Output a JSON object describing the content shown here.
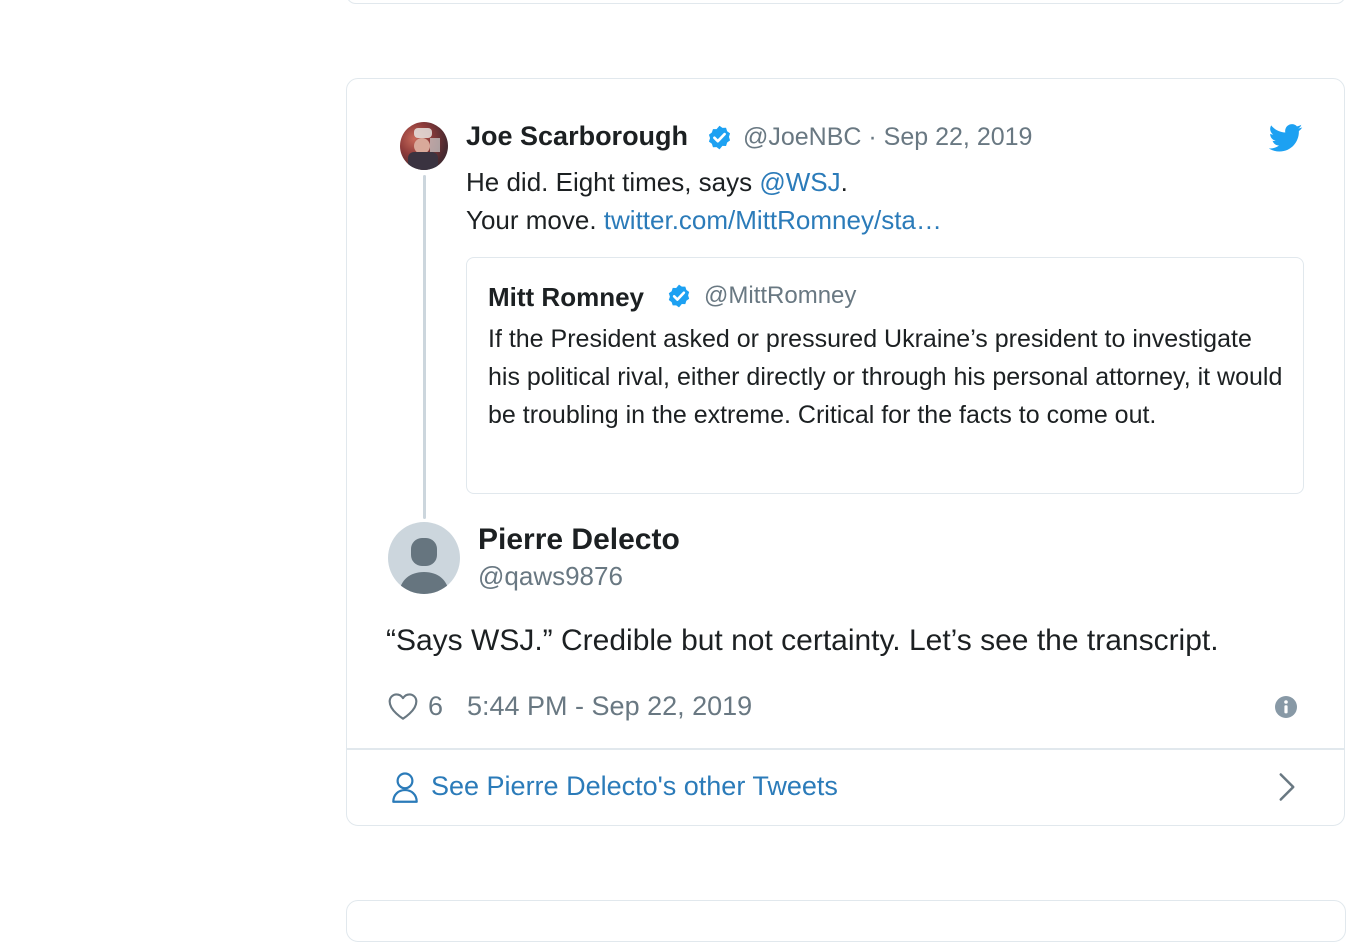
{
  "parent_tweet": {
    "author_name": "Joe Scarborough",
    "meta": "@JoeNBC · Sep 22, 2019",
    "line1_text": "He did. Eight times, says ",
    "line1_mention": "@WSJ",
    "line1_end": ".",
    "line2_text": "Your move. ",
    "line2_link": "twitter.com/MittRomney/sta…"
  },
  "quoted_tweet": {
    "author_name": "Mitt Romney",
    "handle": "@MittRomney",
    "text": "If the President asked or pressured Ukraine’s president to investigate his political rival, either directly or through his personal attorney, it would be troubling in the extreme. Critical for the facts to come out."
  },
  "reply": {
    "author_name": "Pierre Delecto",
    "handle": "@qaws9876",
    "text": "“Says WSJ.” Credible but not certainty. Let’s see the transcript.",
    "likes": "6",
    "timestamp": "5:44 PM - Sep 22, 2019"
  },
  "footer": {
    "see_more_label": "See Pierre Delecto's other Tweets"
  },
  "icons": {
    "verified": "verified-badge-icon",
    "twitter": "twitter-bird-icon",
    "like": "heart-icon",
    "info": "info-icon",
    "profile": "person-icon",
    "chevron": "chevron-right-icon"
  },
  "colors": {
    "link": "#2b7bb9",
    "verified": "#1da1f2",
    "secondary_text": "#697882",
    "border": "#e1e8ed"
  }
}
